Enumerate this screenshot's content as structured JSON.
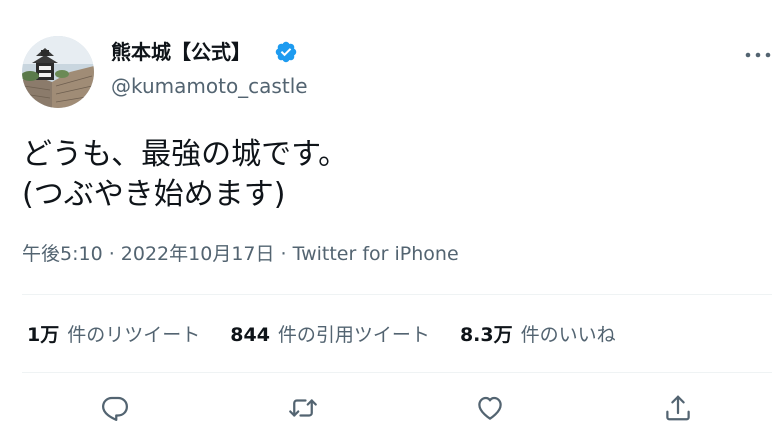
{
  "author": {
    "name": "熊本城【公式】",
    "handle": "@kumamoto_castle",
    "verified": true,
    "avatar_icon": "castle-avatar",
    "verified_color": "#1d9bf0"
  },
  "tweet": {
    "lines": [
      "どうも、最強の城です。",
      "(つぶやき始めます)"
    ],
    "meta": "午後5:10 · 2022年10月17日 · Twitter for iPhone"
  },
  "stats": [
    {
      "value": "1万",
      "label": "件のリツイート"
    },
    {
      "value": "844",
      "label": "件の引用ツイート"
    },
    {
      "value": "8.3万",
      "label": "件のいいね"
    }
  ],
  "actions": [
    {
      "icon": "reply-icon"
    },
    {
      "icon": "retweet-icon"
    },
    {
      "icon": "like-icon"
    },
    {
      "icon": "share-icon"
    }
  ],
  "colors": {
    "text": "#0f1419",
    "secondary": "#536471",
    "divider": "#eff3f4"
  }
}
